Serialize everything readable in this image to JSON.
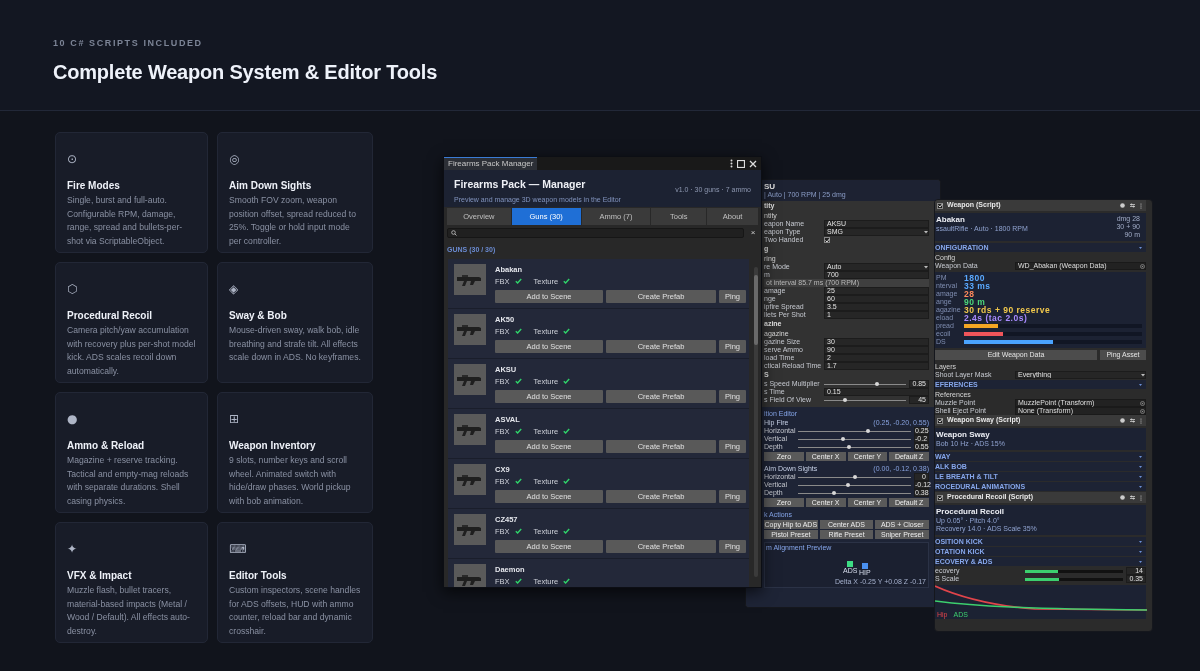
{
  "header": {
    "eyebrow": "10 C# SCRIPTS INCLUDED",
    "title": "Complete Weapon System & Editor Tools"
  },
  "features": [
    {
      "icon": "⊙",
      "title": "Fire Modes",
      "text": "Single, burst and full-auto. Configurable RPM, damage, range, spread and bullets-per-shot via ScriptableObject."
    },
    {
      "icon": "◎",
      "title": "Aim Down Sights",
      "text": "Smooth FOV zoom, weapon position offset, spread reduced to 25%. Toggle or hold input mode per controller."
    },
    {
      "icon": "⬡",
      "title": "Procedural Recoil",
      "text": "Camera pitch/yaw accumulation with recovery plus per-shot model kick. ADS scales recoil down automatically."
    },
    {
      "icon": "◈",
      "title": "Sway & Bob",
      "text": "Mouse-driven sway, walk bob, idle breathing and strafe tilt. All effects scale down in ADS. No keyframes."
    },
    {
      "icon": "●",
      "title": "Ammo & Reload",
      "text": "Magazine + reserve tracking. Tactical and empty-mag reloads with separate durations. Shell casing physics."
    },
    {
      "icon": "⊞",
      "title": "Weapon Inventory",
      "text": "9 slots, number keys and scroll wheel. Animated switch with hide/draw phases. World pickup with bob animation."
    },
    {
      "icon": "✦",
      "title": "VFX & Impact",
      "text": "Muzzle flash, bullet tracers, material-based impacts (Metal / Wood / Default). All effects auto-destroy."
    },
    {
      "icon": "⌨",
      "title": "Editor Tools",
      "text": "Custom inspectors, scene handles for ADS offsets, HUD with ammo counter, reload bar and dynamic crosshair."
    }
  ],
  "manager": {
    "tab_title": "Firearms Pack Manager",
    "title": "Firearms Pack — Manager",
    "subtitle": "Preview and manage 3D weapon models in the Editor",
    "meta": "v1.0 · 30 guns · 7 ammo",
    "tabs": [
      {
        "label": "Overview",
        "selected": false
      },
      {
        "label": "Guns (30)",
        "selected": true
      },
      {
        "label": "Ammo (7)",
        "selected": false
      },
      {
        "label": "Tools",
        "selected": false
      },
      {
        "label": "About",
        "selected": false
      }
    ],
    "clear": "×",
    "list_title": "GUNS (30 / 30)",
    "guns": [
      {
        "name": "Abakan",
        "assets": [
          {
            "label": "FBX",
            "found": true
          },
          {
            "label": "Texture",
            "found": true
          }
        ],
        "buttons": [
          "Add to Scene",
          "Create Prefab",
          "Ping"
        ]
      },
      {
        "name": "AK50",
        "assets": [
          {
            "label": "FBX",
            "found": true
          },
          {
            "label": "Texture",
            "found": true
          }
        ],
        "buttons": [
          "Add to Scene",
          "Create Prefab",
          "Ping"
        ]
      },
      {
        "name": "AKSU",
        "assets": [
          {
            "label": "FBX",
            "found": true
          },
          {
            "label": "Texture",
            "found": true
          }
        ],
        "buttons": [
          "Add to Scene",
          "Create Prefab",
          "Ping"
        ]
      },
      {
        "name": "ASVAL",
        "assets": [
          {
            "label": "FBX",
            "found": true
          },
          {
            "label": "Texture",
            "found": true
          }
        ],
        "buttons": [
          "Add to Scene",
          "Create Prefab",
          "Ping"
        ]
      },
      {
        "name": "CX9",
        "assets": [
          {
            "label": "FBX",
            "found": true
          },
          {
            "label": "Texture",
            "found": true
          }
        ],
        "buttons": [
          "Add to Scene",
          "Create Prefab",
          "Ping"
        ]
      },
      {
        "name": "CZ457",
        "assets": [
          {
            "label": "FBX",
            "found": true
          },
          {
            "label": "Texture",
            "found": true
          }
        ],
        "buttons": [
          "Add to Scene",
          "Create Prefab",
          "Ping"
        ]
      },
      {
        "name": "Daemon",
        "assets": [
          {
            "label": "FBX",
            "found": true
          },
          {
            "label": "Texture",
            "found": true
          }
        ]
      }
    ]
  },
  "inspector": {
    "title": "SU",
    "subtitle": "| Auto | 700 RPM | 25 dmg",
    "rows": [
      {
        "kind": "section",
        "label": "tity"
      },
      {
        "kind": "subhead",
        "label": "ntity"
      },
      {
        "kind": "field",
        "label": "eapon Name",
        "value": "AKSU"
      },
      {
        "kind": "dropdown",
        "label": "eapon Type",
        "value": "SMG"
      },
      {
        "kind": "check",
        "label": "Two Handed",
        "checked": true
      },
      {
        "kind": "section",
        "label": "g"
      },
      {
        "kind": "subhead",
        "label": "ring"
      },
      {
        "kind": "dropdown",
        "label": "re Mode",
        "value": "Auto"
      },
      {
        "kind": "field",
        "label": "m",
        "value": "700"
      },
      {
        "kind": "note",
        "label": "ot interval 85.7 ms (700 RPM)"
      },
      {
        "kind": "field",
        "label": "amage",
        "value": "25"
      },
      {
        "kind": "field",
        "label": "nge",
        "value": "60"
      },
      {
        "kind": "field",
        "label": "ipfire Spread",
        "value": "3.5"
      },
      {
        "kind": "field",
        "label": "llets Per Shot",
        "value": "1"
      },
      {
        "kind": "section",
        "label": "azine"
      },
      {
        "kind": "subhead",
        "label": "agazine"
      },
      {
        "kind": "field",
        "label": "gazine Size",
        "value": "30"
      },
      {
        "kind": "field",
        "label": "serve Ammo",
        "value": "90"
      },
      {
        "kind": "field",
        "label": "load Time",
        "value": "2"
      },
      {
        "kind": "field",
        "label": "ctical Reload Time",
        "value": "1.7"
      },
      {
        "kind": "section",
        "label": "S"
      },
      {
        "kind": "slider",
        "label": "s Speed Multiplier",
        "level": 0.65,
        "reading": "0.85"
      },
      {
        "kind": "field",
        "label": "s Time",
        "value": "0.15"
      },
      {
        "kind": "slider",
        "label": "s Field Of View",
        "level": 0.25,
        "reading": "45"
      }
    ],
    "editor": {
      "title": "ition Editor",
      "groups": [
        {
          "name": "Hip Fire",
          "vector": "(0.25, -0.20, 0.55)",
          "sliders": [
            {
              "label": "Horizontal",
              "level": 0.62,
              "reading": "0.25"
            },
            {
              "label": "Vertical",
              "level": 0.4,
              "reading": "-0.2"
            },
            {
              "label": "Depth",
              "level": 0.45,
              "reading": "0.55"
            }
          ],
          "buttons": [
            "Zero",
            "Center X",
            "Center Y",
            "Default Z"
          ]
        },
        {
          "name": "Aim Down Sights",
          "vector": "(0.00, -0.12, 0.38)",
          "sliders": [
            {
              "label": "Horizontal",
              "level": 0.5,
              "reading": "0"
            },
            {
              "label": "Vertical",
              "level": 0.44,
              "reading": "-0.12"
            },
            {
              "label": "Depth",
              "level": 0.32,
              "reading": "0.38"
            }
          ],
          "buttons": [
            "Zero",
            "Center X",
            "Center Y",
            "Default Z"
          ]
        }
      ],
      "actions_title": "k Actions",
      "action_rows": [
        [
          "Copy Hip to ADS",
          "Center ADS",
          "ADS + Closer"
        ],
        [
          "Pistol Preset",
          "Rifle Preset",
          "Sniper Preset"
        ]
      ],
      "preview": {
        "title": "m Alignment Preview",
        "markers": [
          {
            "label": "ADS",
            "color": "#3ddc84"
          },
          {
            "label": "HIP",
            "color": "#4a90f0"
          }
        ],
        "delta": "Delta X -0.25 Y +0.08 Z -0.17"
      }
    }
  },
  "components": [
    {
      "title": "Weapon (Script)",
      "enabled": true,
      "card": {
        "title": "Abakan",
        "lines": [
          "ssaultRifle · Auto · 1800 RPM"
        ],
        "stats": [
          "dmg 28",
          "30 + 90",
          "90 m"
        ]
      },
      "rows": [
        {
          "kind": "section",
          "label": "ONFIGURATION"
        },
        {
          "kind": "subhead",
          "label": "Config"
        },
        {
          "kind": "object",
          "label": "Weapon Data",
          "value": "WD_Abakan (Weapon Data)"
        },
        {
          "kind": "stats",
          "items": [
            {
              "label": "PM",
              "value": "1800",
              "color": "#5aa9ff"
            },
            {
              "label": "nterval",
              "value": "33 ms",
              "color": "#5aa9ff"
            },
            {
              "label": "amage",
              "value": "28",
              "color": "#ff8a5c"
            },
            {
              "label": "ange",
              "value": "90 m",
              "color": "#4cd97b"
            },
            {
              "label": "agazine",
              "value": "30 rds + 90 reserve",
              "color": "#f2c94c"
            },
            {
              "label": "eload",
              "value": "2.4s (tac 2.0s)",
              "color": "#a98bff"
            }
          ],
          "bars": [
            {
              "label": "pread",
              "level": 0.19,
              "color": "#f5a623"
            },
            {
              "label": "ecoil",
              "level": 0.22,
              "color": "#f0555a"
            },
            {
              "label": "DS",
              "level": 0.5,
              "color": "#4aa3ff"
            }
          ]
        },
        {
          "kind": "buttons",
          "items": [
            "Edit Weapon Data",
            "Ping Asset"
          ]
        },
        {
          "kind": "subhead",
          "label": "Layers"
        },
        {
          "kind": "dropdown",
          "label": "Shoot Layer Mask",
          "value": "Everything"
        },
        {
          "kind": "section",
          "label": "EFERENCES"
        },
        {
          "kind": "subhead",
          "label": "References"
        },
        {
          "kind": "object",
          "label": "Muzzle Point",
          "value": "MuzzlePoint (Transform)"
        },
        {
          "kind": "object",
          "label": "Shell Eject Point",
          "value": "None (Transform)"
        }
      ]
    },
    {
      "title": "Weapon Sway (Script)",
      "enabled": true,
      "card": {
        "title": "Weapon Sway",
        "lines": [
          "Bob 10 Hz · ADS 15%"
        ]
      },
      "rows": [
        {
          "kind": "section",
          "label": "WAY"
        },
        {
          "kind": "section",
          "label": "ALK BOB"
        },
        {
          "kind": "section",
          "label": "LE BREATH & TILT"
        },
        {
          "kind": "section",
          "label": "ROCEDURAL ANIMATIONS"
        }
      ]
    },
    {
      "title": "Procedural Recoil (Script)",
      "enabled": true,
      "card": {
        "title": "Procedural Recoil",
        "lines": [
          "Up 0.05° · Pitch 4.0°",
          "Recovery 14.0 · ADS Scale 35%"
        ]
      },
      "rows": [
        {
          "kind": "section",
          "label": "OSITION KICK"
        },
        {
          "kind": "section",
          "label": "OTATION KICK"
        },
        {
          "kind": "section",
          "label": "ECOVERY & ADS"
        },
        {
          "kind": "slider",
          "label": "ecovery",
          "level": 0.34,
          "reading": "14"
        },
        {
          "kind": "slider",
          "label": "S Scale",
          "level": 0.35,
          "reading": "0.35"
        },
        {
          "kind": "graph",
          "series": [
            {
              "label": "Hip",
              "color": "#e0444a"
            },
            {
              "label": "ADS",
              "color": "#3ccf6e"
            }
          ]
        }
      ]
    }
  ]
}
